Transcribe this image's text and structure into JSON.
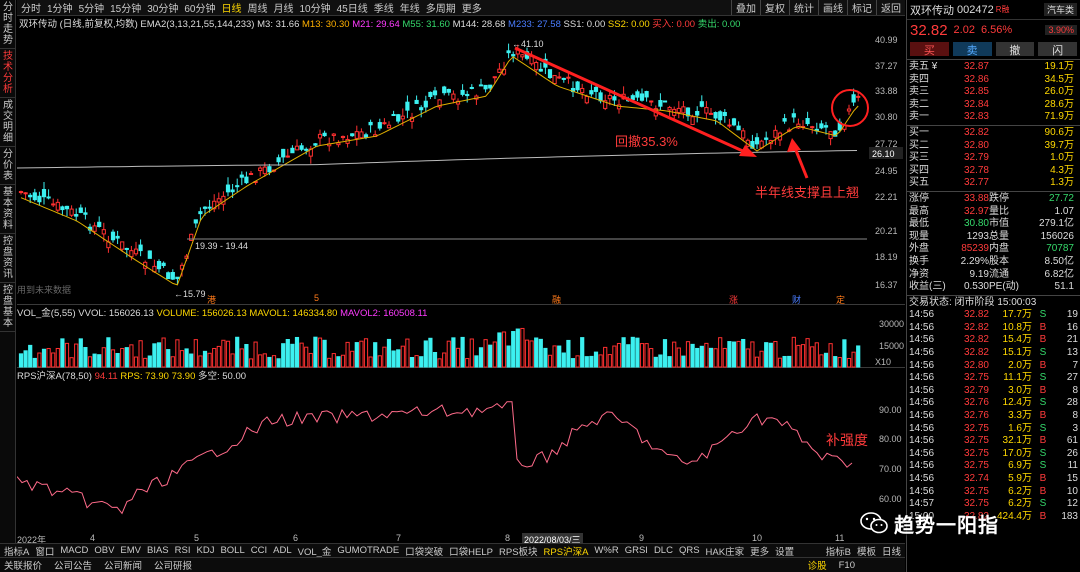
{
  "left_nav": [
    "分时走势",
    "技术分析",
    "成交明细",
    "分价表",
    "基本资料",
    "控盘资讯",
    "控盘基本"
  ],
  "toolbar": {
    "periods": [
      "分时",
      "1分钟",
      "5分钟",
      "15分钟",
      "30分钟",
      "60分钟",
      "日线",
      "周线",
      "月线",
      "10分钟",
      "45日线",
      "季线",
      "年线",
      "多周期",
      "更多"
    ],
    "active": "日线",
    "right_buttons": [
      "叠加",
      "复权",
      "统计",
      "画线",
      "标记",
      "返回"
    ]
  },
  "indicator_line": {
    "name": "双环传动 (日线,前复权,均数)",
    "ema": "EMA2(3,13,21,55,144,233)",
    "m3": "M3: 31.66",
    "m13": "M13: 30.30",
    "m21": "M21: 29.64",
    "m55": "M55: 31.60",
    "m144": "M144: 28.68",
    "m233": "M233: 27.58",
    "ss1": "SS1: 0.00",
    "ss2": "SS2: 0.00",
    "buy": "买入: 0.00",
    "sell": "卖出: 0.00"
  },
  "price_axis": [
    "40.99",
    "37.27",
    "33.88",
    "30.80",
    "27.72",
    "24.95",
    "22.21",
    "20.21",
    "18.19",
    "16.37"
  ],
  "price_tag": "26.10",
  "high_label": "41.10",
  "low_label": "15.79",
  "range_label": "19.39 - 19.44",
  "annotations": {
    "pullback": "回撤35.3%",
    "support": "半年线支撑且上翘",
    "rps": "补强度"
  },
  "future_label": "用到未来数据",
  "event_marks": [
    "港",
    "5",
    "融",
    "涨",
    "财",
    "定"
  ],
  "vol_line": {
    "name": "VOL_金(5,55)",
    "vvol": "VVOL: 156026.13",
    "volume": "VOLUME: 156026.13",
    "mavol1": "MAVOL1: 146334.80",
    "mavol2": "MAVOL2: 160508.11"
  },
  "vol_axis": [
    "30000",
    "15000",
    "X10"
  ],
  "rps_line": {
    "name": "RPS沪深A(78,50)",
    "v1": "94.11",
    "rps": "RPS: 73.90",
    "v3": "73.90",
    "v4": "多空: 50.00"
  },
  "rps_axis": [
    "90.00",
    "80.00",
    "70.00",
    "60.00"
  ],
  "date_axis": {
    "start": "2022年",
    "m4": "4",
    "m5": "5",
    "m6": "6",
    "m7": "7",
    "m8": "8",
    "cursor": "2022/08/03/三",
    "m9": "9",
    "m10": "10",
    "m11": "11"
  },
  "bottom_tabs": [
    "指标A",
    "窗口",
    "MACD",
    "OBV",
    "EMV",
    "BIAS",
    "RSI",
    "KDJ",
    "BOLL",
    "CCI",
    "ADL",
    "VOL_金",
    "GUMOTRADE",
    "口袋突破",
    "口袋HELP",
    "RPS板块",
    "RPS沪深A",
    "W%R",
    "GRSI",
    "DLC",
    "QRS",
    "HAK庄家",
    "更多",
    "设置"
  ],
  "bottom_active": "RPS沪深A",
  "bottom_right": [
    "指标B",
    "模板",
    "日线"
  ],
  "bottom_links": [
    "关联报价",
    "公司公告",
    "公司新闻",
    "公司研报"
  ],
  "status": [
    "诊股",
    "F10"
  ],
  "quote": {
    "name": "双环传动",
    "code": "002472",
    "badge": "R融",
    "sector": "汽车类",
    "price": "32.82",
    "change": "2.02",
    "pct": "6.56%",
    "weibi": "3.90%",
    "actions": [
      "买",
      "卖",
      "撤",
      "闪"
    ],
    "asks": [
      [
        "卖五 ¥",
        "32.87",
        "19.1万"
      ],
      [
        "卖四",
        "32.86",
        "34.5万"
      ],
      [
        "卖三",
        "32.85",
        "26.0万"
      ],
      [
        "卖二",
        "32.84",
        "28.6万"
      ],
      [
        "卖一",
        "32.83",
        "71.9万"
      ]
    ],
    "bids": [
      [
        "买一",
        "32.82",
        "90.6万"
      ],
      [
        "买二",
        "32.80",
        "39.7万"
      ],
      [
        "买三",
        "32.79",
        "1.0万"
      ],
      [
        "买四",
        "32.78",
        "4.3万"
      ],
      [
        "买五",
        "32.77",
        "1.3万"
      ]
    ],
    "stats": [
      [
        "涨停",
        "33.88",
        "跌停",
        "27.72"
      ],
      [
        "最高",
        "32.97",
        "量比",
        "1.07"
      ],
      [
        "最低",
        "30.80",
        "市值",
        "279.1亿"
      ],
      [
        "现量",
        "1293",
        "总量",
        "156026"
      ],
      [
        "外盘",
        "85239",
        "内盘",
        "70787"
      ],
      [
        "换手",
        "2.29%",
        "股本",
        "8.50亿"
      ],
      [
        "净资",
        "9.19",
        "流通",
        "6.82亿"
      ],
      [
        "收益(三)",
        "0.530",
        "PE(动)",
        "51.1"
      ]
    ],
    "trade_status": "交易状态: 闭市阶段 15:00:03",
    "ticks": [
      [
        "14:56",
        "32.82",
        "17.7万",
        "S",
        "19"
      ],
      [
        "14:56",
        "32.82",
        "10.8万",
        "B",
        "16"
      ],
      [
        "14:56",
        "32.82",
        "15.4万",
        "B",
        "21"
      ],
      [
        "14:56",
        "32.82",
        "15.1万",
        "S",
        "13"
      ],
      [
        "14:56",
        "32.80",
        "2.0万",
        "B",
        "7"
      ],
      [
        "14:56",
        "32.75",
        "11.1万",
        "S",
        "27"
      ],
      [
        "14:56",
        "32.79",
        "3.0万",
        "B",
        "8"
      ],
      [
        "14:56",
        "32.76",
        "12.4万",
        "S",
        "28"
      ],
      [
        "14:56",
        "32.76",
        "3.3万",
        "B",
        "8"
      ],
      [
        "14:56",
        "32.75",
        "1.6万",
        "S",
        "3"
      ],
      [
        "14:56",
        "32.75",
        "32.1万",
        "B",
        "61"
      ],
      [
        "14:56",
        "32.75",
        "17.0万",
        "S",
        "26"
      ],
      [
        "14:56",
        "32.75",
        "6.9万",
        "S",
        "11"
      ],
      [
        "14:56",
        "32.74",
        "5.9万",
        "B",
        "15"
      ],
      [
        "14:56",
        "32.75",
        "6.2万",
        "B",
        "10"
      ],
      [
        "14:57",
        "32.75",
        "6.2万",
        "S",
        "12"
      ],
      [
        "15:00",
        "32.82",
        "424.4万",
        "B",
        "183"
      ]
    ]
  },
  "watermark": "趋势一阳指"
}
